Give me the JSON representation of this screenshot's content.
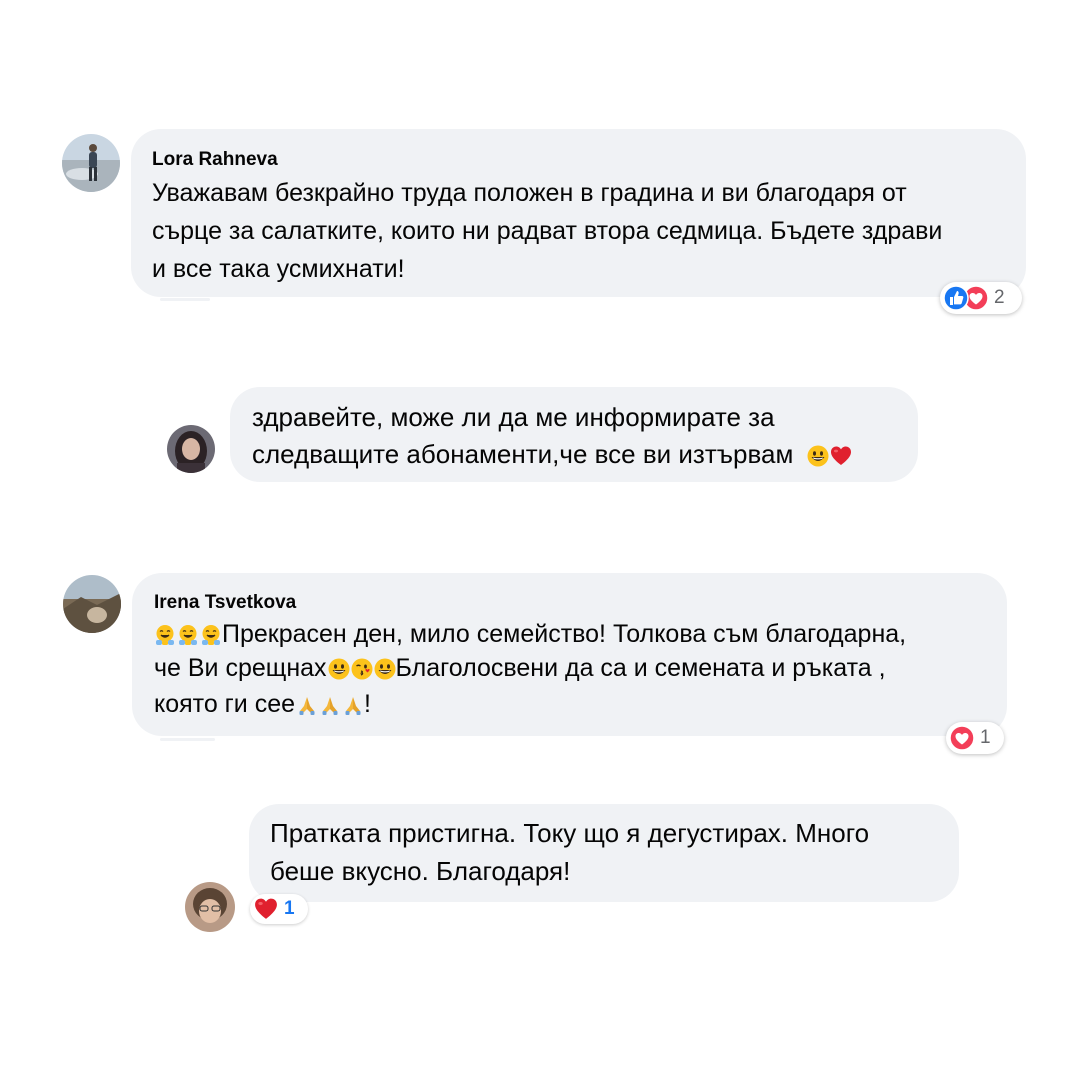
{
  "comments": [
    {
      "author": "Lora Rahneva",
      "lines": [
        "Уважавам безкрайно труда положен в градина и ви благодаря от",
        "сърце за салатките, които ни радват втора седмица. Бъдете здрави",
        "и все така усмихнати!"
      ],
      "reactions": {
        "icons": [
          "like-icon",
          "love-icon"
        ],
        "count": "2"
      },
      "colors": {
        "like": "#1877f2",
        "love": "#f33e58"
      }
    },
    {
      "author": "",
      "lines": [
        "здравейте, може ли да ме информирате за",
        "следващите абонаменти,че все ви изтървам"
      ],
      "emoji_after": [
        "grinning-face-emoji",
        "red-heart-emoji"
      ]
    },
    {
      "author": "Irena Tsvetkova",
      "lines": [
        "Прекрасен ден, мило семейство! Толкова съм благодарна,",
        "че Ви срещнах",
        "Благолосвени да са и семената и ръката ,",
        "която ги сее",
        "!"
      ],
      "reactions": {
        "icons": [
          "love-icon"
        ],
        "count": "1"
      }
    },
    {
      "author": "",
      "lines": [
        "Пратката пристигна. Току що я дегустирах. Много",
        "беше вкусно. Благодаря!"
      ],
      "reactions": {
        "icons": [
          "red-heart-emoji"
        ],
        "count": "1"
      }
    }
  ],
  "colors": {
    "bubble": "#f0f2f5",
    "text": "#050505",
    "count_gray": "#65676b",
    "count_blue": "#1877f2",
    "love": "#f33e58",
    "like": "#1877f2"
  }
}
